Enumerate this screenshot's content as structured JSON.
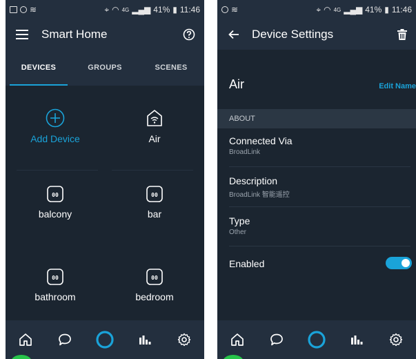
{
  "left": {
    "status": {
      "time": "11:46",
      "battery": "41%",
      "network": "4G"
    },
    "appbar": {
      "title": "Smart Home"
    },
    "tabs": [
      {
        "label": "DEVICES",
        "active": true
      },
      {
        "label": "GROUPS",
        "active": false
      },
      {
        "label": "SCENES",
        "active": false
      }
    ],
    "devices": [
      {
        "label": "Add Device",
        "icon": "add-circle-icon"
      },
      {
        "label": "Air",
        "icon": "house-wifi-icon"
      },
      {
        "label": "balcony",
        "icon": "plug-icon"
      },
      {
        "label": "bar",
        "icon": "plug-icon"
      },
      {
        "label": "bathroom",
        "icon": "plug-icon"
      },
      {
        "label": "bedroom",
        "icon": "plug-icon"
      }
    ],
    "plug_glyph": "00"
  },
  "right": {
    "status": {
      "time": "11:46",
      "battery": "41%",
      "network": "4G"
    },
    "appbar": {
      "title": "Device Settings"
    },
    "device_name": "Air",
    "edit_label": "Edit Name",
    "section_label": "ABOUT",
    "items": [
      {
        "title": "Connected Via",
        "subtitle": "BroadLink"
      },
      {
        "title": "Description",
        "subtitle": "BroadLink 智能遥控"
      },
      {
        "title": "Type",
        "subtitle": "Other"
      }
    ],
    "enabled_label": "Enabled",
    "enabled": true
  },
  "colors": {
    "bg": "#232f3e",
    "panel": "#1b2530",
    "accent": "#1aa3d9",
    "alexa_ring": "#1aa3d9"
  }
}
